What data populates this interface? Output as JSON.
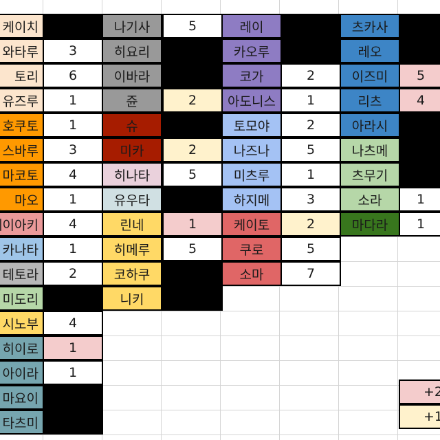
{
  "colors": {
    "light_orange": "#fce5cd",
    "orange": "#ff9900",
    "salmon": "#ea9999",
    "light_blue": "#9fc5e8",
    "gray": "#b7b7b7",
    "light_green": "#b6d7a8",
    "yellow": "#ffd966",
    "teal": "#76a5af",
    "dark_gray": "#999999",
    "dark_red": "#cc0000",
    "dark_red2": "#a61c00",
    "light_pink": "#ead1dc",
    "light_cyan": "#d0e0e3",
    "purple": "#8e7cc3",
    "blue": "#3d85c6",
    "medium_blue": "#a4c2f4",
    "red": "#e06666",
    "green": "#38761d",
    "pink_value": "#f4cccc",
    "cream_value": "#fff2cc"
  },
  "columns": [
    {
      "rows": [
        {
          "name": "케이치",
          "color": "#fce5cd",
          "value": null,
          "style": "black"
        },
        {
          "name": "와타루",
          "color": "#fce5cd",
          "value": "3",
          "style": "val"
        },
        {
          "name": "토리",
          "color": "#fce5cd",
          "value": "6",
          "style": "val"
        },
        {
          "name": "유즈루",
          "color": "#fce5cd",
          "value": "1",
          "style": "val"
        },
        {
          "name": "호쿠토",
          "color": "#ff9900",
          "value": "1",
          "style": "val"
        },
        {
          "name": "스바루",
          "color": "#ff9900",
          "value": "3",
          "style": "val"
        },
        {
          "name": "마코토",
          "color": "#ff9900",
          "value": "4",
          "style": "val"
        },
        {
          "name": "마오",
          "color": "#ff9900",
          "value": "1",
          "style": "val"
        },
        {
          "name": "레이아키",
          "color": "#ea9999",
          "value": "4",
          "style": "val"
        },
        {
          "name": "카나타",
          "color": "#9fc5e8",
          "value": "1",
          "style": "val"
        },
        {
          "name": "테토라",
          "color": "#b7b7b7",
          "value": "2",
          "style": "val"
        },
        {
          "name": "미도리",
          "color": "#b6d7a8",
          "value": null,
          "style": "black"
        },
        {
          "name": "시노부",
          "color": "#ffd966",
          "value": "4",
          "style": "val"
        },
        {
          "name": "히이로",
          "color": "#76a5af",
          "value": "1",
          "style": "pink"
        },
        {
          "name": "아이라",
          "color": "#76a5af",
          "value": "1",
          "style": "val"
        },
        {
          "name": "마요이",
          "color": "#76a5af",
          "value": null,
          "style": "black"
        },
        {
          "name": "타츠미",
          "color": "#76a5af",
          "value": null,
          "style": "black"
        }
      ]
    },
    {
      "rows": [
        {
          "name": "나기사",
          "color": "#999999",
          "value": "5",
          "style": "val"
        },
        {
          "name": "히요리",
          "color": "#999999",
          "value": null,
          "style": "black"
        },
        {
          "name": "이바라",
          "color": "#999999",
          "value": null,
          "style": "black"
        },
        {
          "name": "쥰",
          "color": "#999999",
          "value": "2",
          "style": "cream"
        },
        {
          "name": "슈",
          "color": "#a61c00",
          "value": null,
          "style": "black"
        },
        {
          "name": "미카",
          "color": "#a61c00",
          "value": "2",
          "style": "cream"
        },
        {
          "name": "히나타",
          "color": "#ead1dc",
          "value": "5",
          "style": "val"
        },
        {
          "name": "유우타",
          "color": "#d0e0e3",
          "value": null,
          "style": "black"
        },
        {
          "name": "린네",
          "color": "#ffd966",
          "value": "1",
          "style": "pink"
        },
        {
          "name": "히메루",
          "color": "#ffd966",
          "value": "5",
          "style": "val"
        },
        {
          "name": "코하쿠",
          "color": "#ffd966",
          "value": null,
          "style": "black"
        },
        {
          "name": "니키",
          "color": "#ffd966",
          "value": null,
          "style": "black"
        }
      ]
    },
    {
      "rows": [
        {
          "name": "레이",
          "color": "#8e7cc3",
          "value": null,
          "style": "black"
        },
        {
          "name": "카오루",
          "color": "#8e7cc3",
          "value": null,
          "style": "black"
        },
        {
          "name": "코가",
          "color": "#8e7cc3",
          "value": "2",
          "style": "val"
        },
        {
          "name": "아도니스",
          "color": "#8e7cc3",
          "value": "1",
          "style": "val"
        },
        {
          "name": "토모야",
          "color": "#a4c2f4",
          "value": "2",
          "style": "val"
        },
        {
          "name": "나즈나",
          "color": "#a4c2f4",
          "value": "5",
          "style": "val"
        },
        {
          "name": "미츠루",
          "color": "#a4c2f4",
          "value": "1",
          "style": "val"
        },
        {
          "name": "하지메",
          "color": "#a4c2f4",
          "value": "3",
          "style": "val"
        },
        {
          "name": "케이토",
          "color": "#e06666",
          "value": "2",
          "style": "cream"
        },
        {
          "name": "쿠로",
          "color": "#e06666",
          "value": "5",
          "style": "val"
        },
        {
          "name": "소마",
          "color": "#e06666",
          "value": "7",
          "style": "val"
        }
      ]
    },
    {
      "rows": [
        {
          "name": "츠카사",
          "color": "#3d85c6",
          "value": null,
          "style": "black"
        },
        {
          "name": "레오",
          "color": "#3d85c6",
          "value": null,
          "style": "black"
        },
        {
          "name": "이즈미",
          "color": "#3d85c6",
          "value": "5",
          "style": "pink"
        },
        {
          "name": "리츠",
          "color": "#3d85c6",
          "value": "4",
          "style": "pink"
        },
        {
          "name": "아라시",
          "color": "#3d85c6",
          "value": null,
          "style": "black"
        },
        {
          "name": "나츠메",
          "color": "#b6d7a8",
          "value": null,
          "style": "black"
        },
        {
          "name": "츠무기",
          "color": "#b6d7a8",
          "value": null,
          "style": "black"
        },
        {
          "name": "소라",
          "color": "#b6d7a8",
          "value": "1",
          "style": "val"
        },
        {
          "name": "마다라",
          "color": "#38761d",
          "value": "1",
          "style": "val"
        }
      ]
    }
  ],
  "legend": [
    {
      "label": "+2",
      "color": "#f4cccc"
    },
    {
      "label": "+1",
      "color": "#fff2cc"
    }
  ]
}
